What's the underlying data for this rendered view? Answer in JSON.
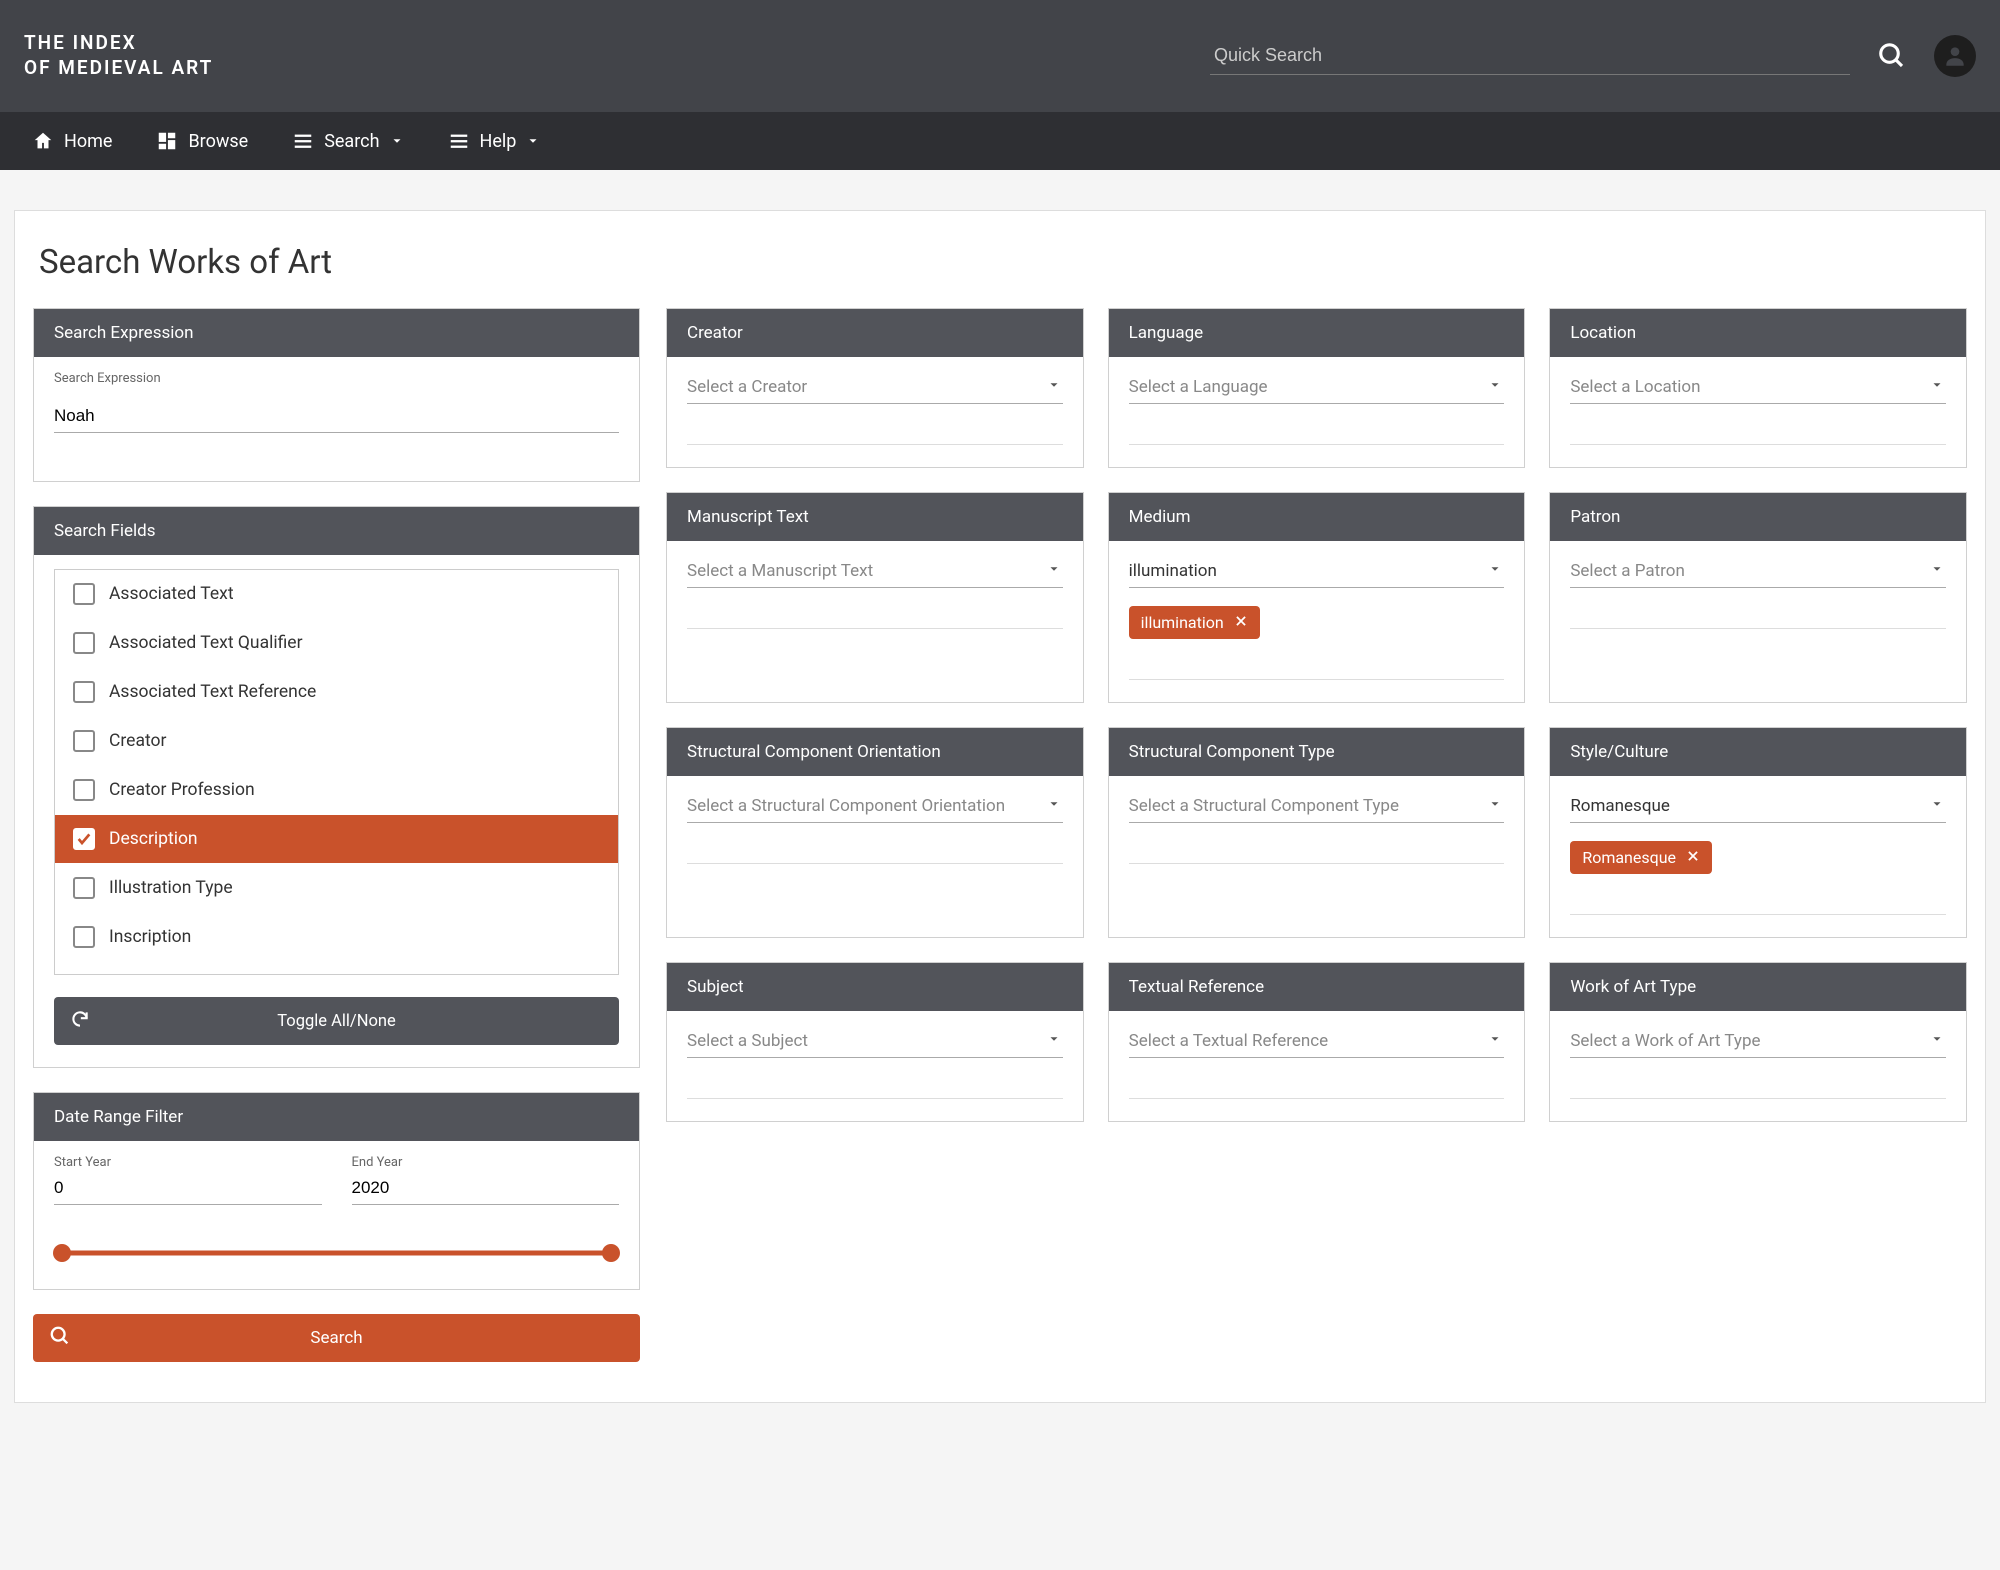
{
  "header": {
    "logo_line1": "THE INDEX",
    "logo_line2": "OF MEDIEVAL ART",
    "quick_search_placeholder": "Quick Search"
  },
  "menubar": {
    "home": "Home",
    "browse": "Browse",
    "search": "Search",
    "help": "Help"
  },
  "page": {
    "title": "Search Works of Art"
  },
  "search_expression": {
    "header": "Search Expression",
    "label": "Search Expression",
    "value": "Noah"
  },
  "search_fields": {
    "header": "Search Fields",
    "items": [
      {
        "label": "Associated Text",
        "selected": false
      },
      {
        "label": "Associated Text Qualifier",
        "selected": false
      },
      {
        "label": "Associated Text Reference",
        "selected": false
      },
      {
        "label": "Creator",
        "selected": false
      },
      {
        "label": "Creator Profession",
        "selected": false
      },
      {
        "label": "Description",
        "selected": true
      },
      {
        "label": "Illustration Type",
        "selected": false
      },
      {
        "label": "Inscription",
        "selected": false
      }
    ],
    "toggle_label": "Toggle All/None"
  },
  "date_range": {
    "header": "Date Range Filter",
    "start_label": "Start Year",
    "start_value": "0",
    "end_label": "End Year",
    "end_value": "2020"
  },
  "search_button": "Search",
  "facets": {
    "creator": {
      "header": "Creator",
      "placeholder": "Select a Creator",
      "value": "",
      "chips": []
    },
    "language": {
      "header": "Language",
      "placeholder": "Select a Language",
      "value": "",
      "chips": []
    },
    "location": {
      "header": "Location",
      "placeholder": "Select a Location",
      "value": "",
      "chips": []
    },
    "manuscript": {
      "header": "Manuscript Text",
      "placeholder": "Select a Manuscript Text",
      "value": "",
      "chips": []
    },
    "medium": {
      "header": "Medium",
      "placeholder": "",
      "value": "illumination",
      "chips": [
        "illumination"
      ]
    },
    "patron": {
      "header": "Patron",
      "placeholder": "Select a Patron",
      "value": "",
      "chips": []
    },
    "sc_orient": {
      "header": "Structural Component Orientation",
      "placeholder": "Select a Structural Component Orientation",
      "value": "",
      "chips": []
    },
    "sc_type": {
      "header": "Structural Component Type",
      "placeholder": "Select a Structural Component Type",
      "value": "",
      "chips": []
    },
    "style": {
      "header": "Style/Culture",
      "placeholder": "",
      "value": "Romanesque",
      "chips": [
        "Romanesque"
      ]
    },
    "subject": {
      "header": "Subject",
      "placeholder": "Select a Subject",
      "value": "",
      "chips": []
    },
    "textual": {
      "header": "Textual Reference",
      "placeholder": "Select a Textual Reference",
      "value": "",
      "chips": []
    },
    "wtype": {
      "header": "Work of Art Type",
      "placeholder": "Select a Work of Art Type",
      "value": "",
      "chips": []
    }
  }
}
